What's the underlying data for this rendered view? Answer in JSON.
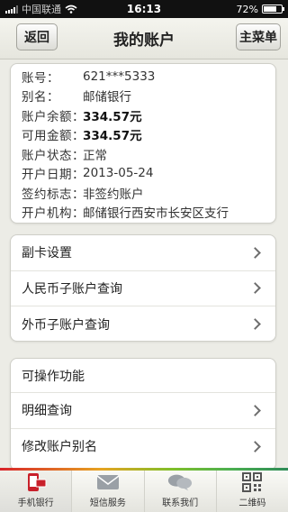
{
  "statusbar": {
    "carrier": "中国联通",
    "time": "16:13",
    "battery": "72%",
    "battery_level": 0.72
  },
  "nav": {
    "back_label": "返回",
    "title": "我的账户",
    "menu_label": "主菜单"
  },
  "account": {
    "rows": [
      {
        "label": "账号：",
        "value": "621***5333"
      },
      {
        "label": "别名：",
        "value": "邮储银行"
      },
      {
        "label": "账户余额：",
        "value": "334.57元"
      },
      {
        "label": "可用金额：",
        "value": "334.57元"
      },
      {
        "label": "账户状态：",
        "value": "正常"
      },
      {
        "label": "开户日期：",
        "value": "2013-05-24"
      },
      {
        "label": "签约标志：",
        "value": "非签约账户"
      },
      {
        "label": "开户机构：",
        "value": "邮储银行西安市长安区支行"
      }
    ]
  },
  "submenu": {
    "items": [
      {
        "label": "副卡设置"
      },
      {
        "label": "人民币子账户查询"
      },
      {
        "label": "外币子账户查询"
      }
    ]
  },
  "operations": {
    "header": "可操作功能",
    "items": [
      {
        "label": "明细查询"
      },
      {
        "label": "修改账户别名"
      }
    ]
  },
  "tabbar": {
    "tabs": [
      {
        "label": "手机银行",
        "icon": "phone-bank-icon"
      },
      {
        "label": "短信服务",
        "icon": "envelope-icon"
      },
      {
        "label": "联系我们",
        "icon": "chat-bubbles-icon"
      },
      {
        "label": "二维码",
        "icon": "qr-code-icon"
      }
    ]
  },
  "colors": {
    "accent_red": "#d8232a",
    "accent_green": "#4caf50"
  }
}
